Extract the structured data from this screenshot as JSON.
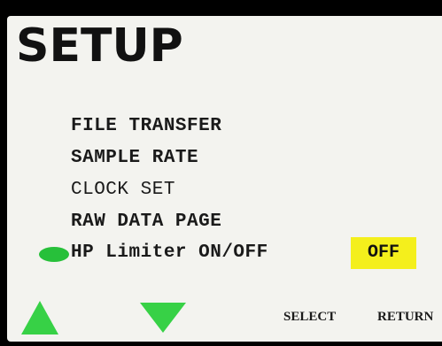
{
  "screen": {
    "title": "SETUP"
  },
  "menu": {
    "items": [
      {
        "label": "FILE TRANSFER"
      },
      {
        "label": "SAMPLE RATE"
      },
      {
        "label": "CLOCK SET"
      },
      {
        "label": "RAW DATA PAGE"
      },
      {
        "label": "HP Limiter ON/OFF"
      }
    ],
    "selected_index": 4,
    "selected_status": "OFF"
  },
  "softkeys": {
    "up_icon": "triangle-up",
    "down_icon": "triangle-down",
    "select_label": "SELECT",
    "return_label": "RETURN"
  },
  "colors": {
    "background": "#f3f3ef",
    "selector": "#27c03a",
    "arrows": "#37d146",
    "status_highlight": "#f4ef1c",
    "text": "#111111"
  }
}
